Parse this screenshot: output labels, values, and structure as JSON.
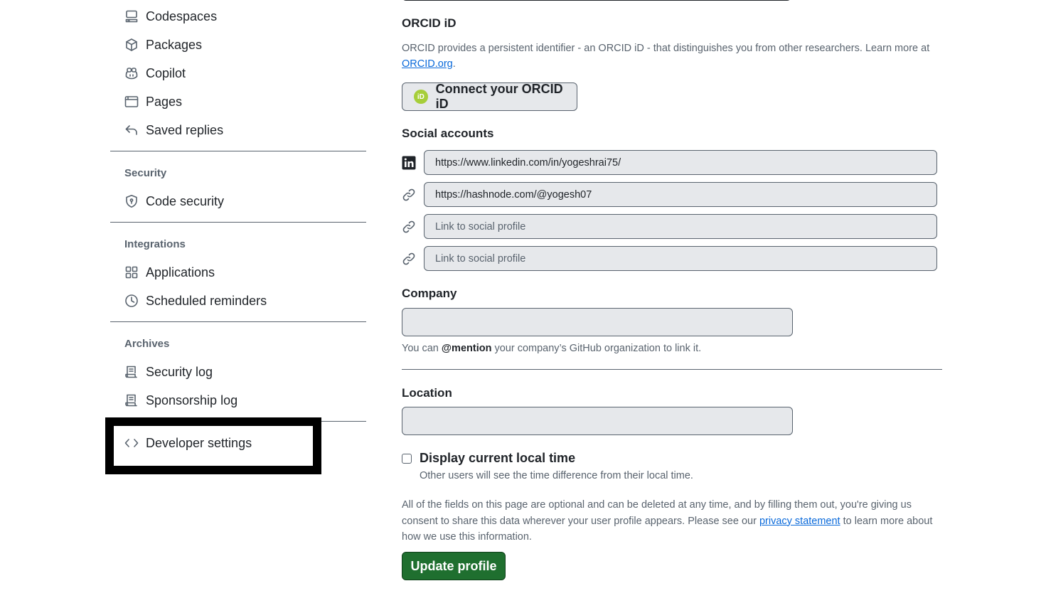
{
  "sidebar": {
    "items_top": [
      {
        "label": "Codespaces",
        "icon": "codespaces-icon"
      },
      {
        "label": "Packages",
        "icon": "package-icon"
      },
      {
        "label": "Copilot",
        "icon": "copilot-icon"
      },
      {
        "label": "Pages",
        "icon": "browser-icon"
      },
      {
        "label": "Saved replies",
        "icon": "reply-icon"
      }
    ],
    "security": {
      "heading": "Security",
      "items": [
        {
          "label": "Code security",
          "icon": "shield-icon"
        }
      ]
    },
    "integrations": {
      "heading": "Integrations",
      "items": [
        {
          "label": "Applications",
          "icon": "apps-icon"
        },
        {
          "label": "Scheduled reminders",
          "icon": "clock-icon"
        }
      ]
    },
    "archives": {
      "heading": "Archives",
      "items": [
        {
          "label": "Security log",
          "icon": "log-icon"
        },
        {
          "label": "Sponsorship log",
          "icon": "log-icon"
        }
      ]
    },
    "developer_settings": {
      "label": "Developer settings",
      "icon": "code-icon"
    }
  },
  "orcid": {
    "heading": "ORCID iD",
    "description": "ORCID provides a persistent identifier - an ORCID iD - that distinguishes you from other researchers. Learn more at",
    "link_text": "ORCID.org",
    "link_suffix": ".",
    "button_label": "Connect your ORCID iD",
    "logo_text": "iD"
  },
  "social": {
    "heading": "Social accounts",
    "accounts": [
      {
        "icon": "linkedin-icon",
        "value": "https://www.linkedin.com/in/yogeshrai75/",
        "placeholder": "Link to social profile"
      },
      {
        "icon": "link-icon",
        "value": "https://hashnode.com/@yogesh07",
        "placeholder": "Link to social profile"
      },
      {
        "icon": "link-icon",
        "value": "",
        "placeholder": "Link to social profile"
      },
      {
        "icon": "link-icon",
        "value": "",
        "placeholder": "Link to social profile"
      }
    ]
  },
  "company": {
    "label": "Company",
    "value": "",
    "help_prefix": "You can ",
    "help_mention": "@mention",
    "help_suffix": " your company’s GitHub organization to link it."
  },
  "location": {
    "label": "Location",
    "value": ""
  },
  "local_time": {
    "label": "Display current local time",
    "checked": false,
    "help": "Other users will see the time difference from their local time."
  },
  "consent": {
    "text_before": "All of the fields on this page are optional and can be deleted at any time, and by filling them out, you're giving us consent to share this data wherever your user profile appears. Please see our ",
    "link_text": "privacy statement",
    "text_after": " to learn more about how we use this information."
  },
  "update_button": "Update profile",
  "colors": {
    "accent_green": "#1f6f2f",
    "link_blue": "#0969da",
    "input_bg": "#e6e8eb",
    "orcid_green": "#a6ce39"
  }
}
